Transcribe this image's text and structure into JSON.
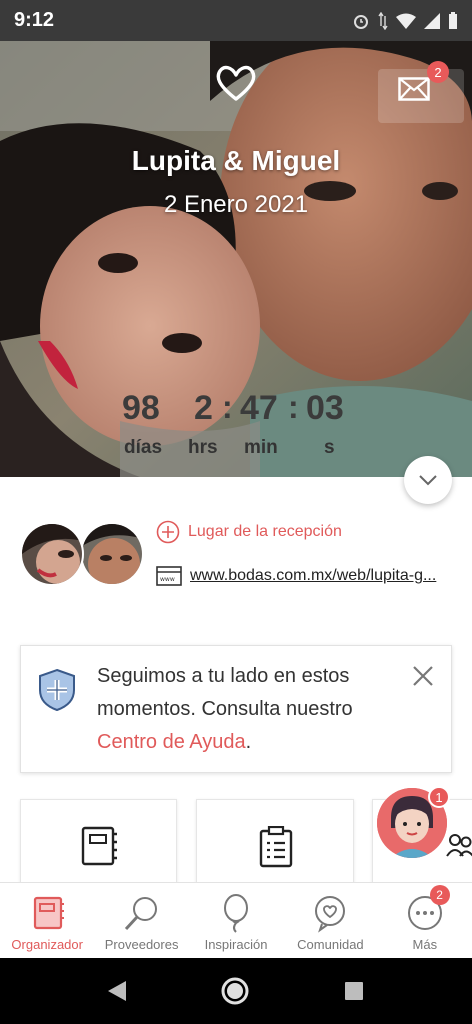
{
  "status_bar": {
    "time": "9:12"
  },
  "hero": {
    "mail_badge_count": "2",
    "couple_names": "Lupita & Miguel",
    "wedding_date": "2 Enero 2021",
    "countdown": {
      "days": "98",
      "hours": "2",
      "minutes": "47",
      "seconds": "03",
      "days_label": "días",
      "hours_label": "hrs",
      "minutes_label": "min",
      "seconds_label": "s"
    }
  },
  "info": {
    "reception_label": "Lugar de la recepción",
    "website_url": "www.bodas.com.mx/web/lupita-g..."
  },
  "notice": {
    "text_before": "Seguimos a tu lado en estos momentos. Consulta nuestro ",
    "link_text": "Centro de Ayuda",
    "text_after": "."
  },
  "help_badge_count": "1",
  "bottom_nav": {
    "items": [
      {
        "label": "Organizador",
        "active": true
      },
      {
        "label": "Proveedores",
        "active": false
      },
      {
        "label": "Inspiración",
        "active": false
      },
      {
        "label": "Comunidad",
        "active": false
      },
      {
        "label": "Más",
        "active": false,
        "badge": "2"
      }
    ]
  },
  "colors": {
    "accent": "#e05a5a",
    "badge": "#e85a5a",
    "status_bar": "#3a3a3a"
  }
}
